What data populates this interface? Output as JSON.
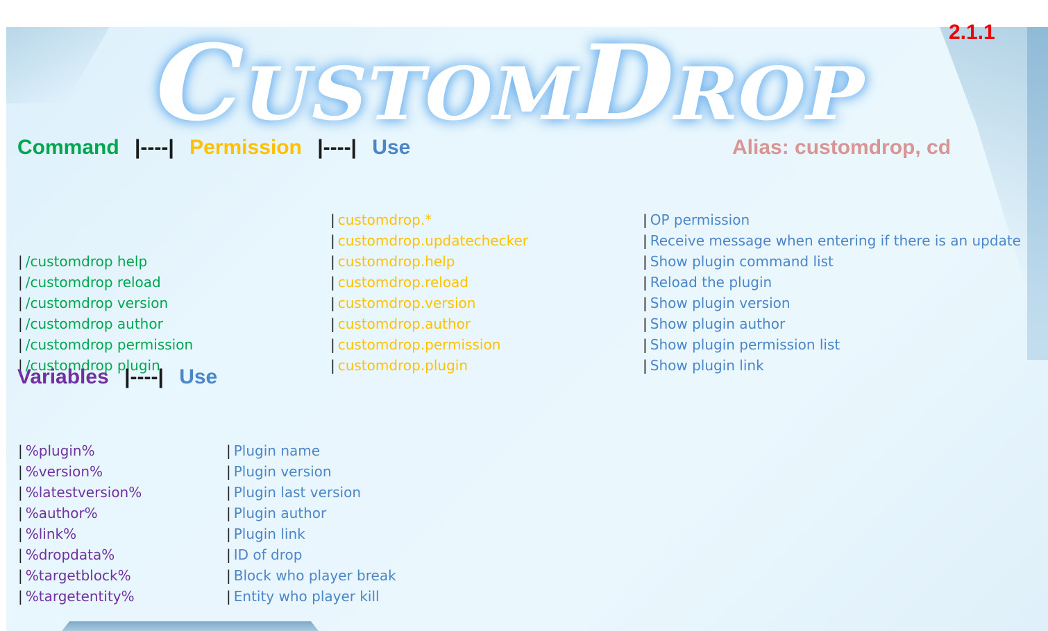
{
  "logo_text": "CustomDrop",
  "version": "2.1.1",
  "commands_header": {
    "command": "Command",
    "sep1": "|----|",
    "permission": "Permission",
    "sep2": "|----|",
    "use": "Use",
    "alias": "Alias: customdrop, cd"
  },
  "separator_char": "|",
  "commands": [
    "/customdrop help",
    "/customdrop reload",
    "/customdrop version",
    "/customdrop author",
    "/customdrop permission",
    "/customdrop plugin"
  ],
  "permissions": [
    "customdrop.*",
    "customdrop.updatechecker",
    "customdrop.help",
    "customdrop.reload",
    "customdrop.version",
    "customdrop.author",
    "customdrop.permission",
    "customdrop.plugin"
  ],
  "uses": [
    "OP permission",
    "Receive message when entering if there is an update",
    "Show plugin command list",
    "Reload the plugin",
    "Show plugin version",
    "Show plugin author",
    "Show plugin permission list",
    "Show plugin link"
  ],
  "variables_header": {
    "variables": "Variables",
    "sep": "|----|",
    "use": "Use"
  },
  "variables": [
    "%plugin%",
    "%version%",
    "%latestversion%",
    "%author%",
    "%link%",
    "%dropdata%",
    "%targetblock%",
    "%targetentity%"
  ],
  "variable_uses": [
    "Plugin name",
    "Plugin version",
    "Plugin last version",
    "Plugin author",
    "Plugin link",
    "ID of drop",
    "Block who player break",
    "Entity who player kill"
  ]
}
